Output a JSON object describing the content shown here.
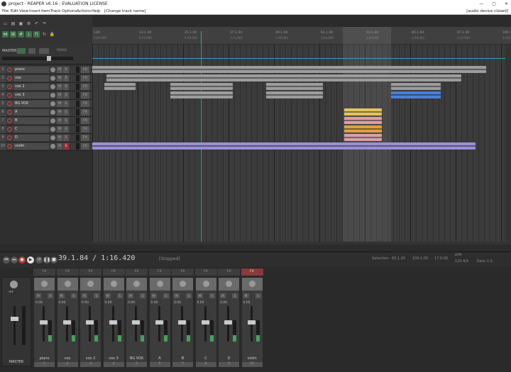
{
  "window": {
    "title": "project - REAPER v6.16 - EVALUATION LICENSE",
    "buttons": [
      "—",
      "▢",
      "✕"
    ]
  },
  "menu": {
    "items": [
      "File",
      "Edit",
      "View",
      "Insert",
      "Item",
      "Track",
      "Options",
      "Actions",
      "Help"
    ],
    "change_track": "[Change track name]",
    "device": "[audio device closed]"
  },
  "master": {
    "label": "MASTER",
    "mono": "MONO"
  },
  "tracks": [
    {
      "num": "1",
      "name": "piano"
    },
    {
      "num": "2",
      "name": "vox"
    },
    {
      "num": "3",
      "name": "vox 2"
    },
    {
      "num": "4",
      "name": "vox 3"
    },
    {
      "num": "5",
      "name": "BG VOX"
    },
    {
      "num": "6",
      "name": "A"
    },
    {
      "num": "7",
      "name": "B"
    },
    {
      "num": "8",
      "name": "C"
    },
    {
      "num": "9",
      "name": "D"
    },
    {
      "num": "10",
      "name": "violin"
    }
  ],
  "ruler": {
    "marks": [
      "129",
      "13.1.00",
      "25.1.00",
      "37.1.00",
      "49.1.00",
      "61.1.00",
      "73.1.00",
      "85.1.00",
      "97.1.00",
      "109.1.00",
      "121.1.00"
    ],
    "times": [
      "0:00.000",
      "0:24.000",
      "0:48.000",
      "1:12.000",
      "1:36.000",
      "2:00.000",
      "2:24.000",
      "2:48.000",
      "3:12.000",
      "3:36.000",
      "4:00.000"
    ]
  },
  "transport": {
    "position": "39.1.84 / 1:16.420",
    "status": "[Stopped]",
    "selection_label": "Selection:",
    "sel_start": "83.1.00",
    "sel_end": "100.1.00",
    "sel_len": "17.0.00",
    "bpm_label": "BPM",
    "bpm": "120",
    "timesig": "4/4",
    "rate_label": "Rate:",
    "rate": "1.0"
  },
  "mixer": {
    "master_label": "MASTER",
    "master_db": "-inf",
    "strips": [
      {
        "name": "piano",
        "num": "1",
        "db": "0.00"
      },
      {
        "name": "vox",
        "num": "2",
        "db": "0.00"
      },
      {
        "name": "vox 2",
        "num": "3",
        "db": "0.00"
      },
      {
        "name": "vox 3",
        "num": "4",
        "db": "0.00"
      },
      {
        "name": "BG VOX",
        "num": "5",
        "db": "0.00"
      },
      {
        "name": "A",
        "num": "6",
        "db": "0.00"
      },
      {
        "name": "B",
        "num": "7",
        "db": "0.00"
      },
      {
        "name": "C",
        "num": "8",
        "db": "0.00"
      },
      {
        "name": "D",
        "num": "9",
        "db": "0.00"
      },
      {
        "name": "violin",
        "num": "10",
        "db": "0.00"
      }
    ]
  },
  "colors": {
    "accent": "#3f6e4b",
    "violin_clip": "#9a8fd6",
    "selection_clip_blue": "#4a7fd6",
    "selection_clip_yellow": "#e4c35a",
    "selection_clip_orange": "#e0a040",
    "selection_clip_pink": "#d9a0a8"
  }
}
